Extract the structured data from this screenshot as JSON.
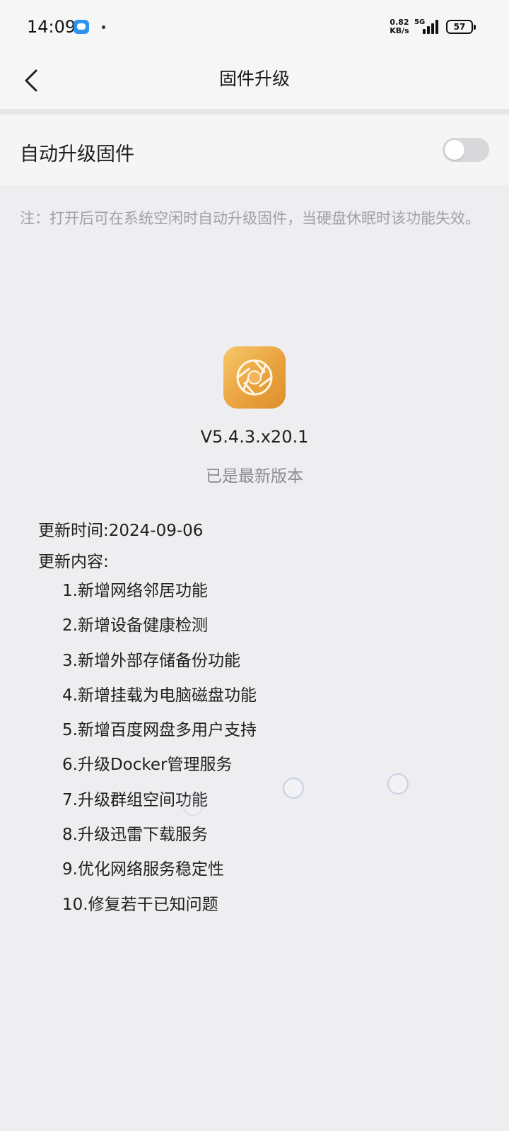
{
  "status_bar": {
    "time": "14:09",
    "speed_value": "0.82",
    "speed_unit": "KB/s",
    "network": "5G",
    "battery": "57"
  },
  "nav": {
    "title": "固件升级",
    "back_icon": "chevron-left-icon"
  },
  "settings": {
    "auto_upgrade_label": "自动升级固件",
    "auto_upgrade_enabled": false
  },
  "note": "注：打开后可在系统空闲时自动升级固件，当硬盘休眠时该功能失效。",
  "firmware": {
    "logo_icon": "aperture-icon",
    "version": "V5.4.3.x20.1",
    "status": "已是最新版本",
    "update_time": "更新时间:2024-09-06",
    "update_content_label": "更新内容:",
    "changelog": [
      "1.新增网络邻居功能",
      "2.新增设备健康检测",
      "3.新增外部存储备份功能",
      "4.新增挂载为电脑磁盘功能",
      "5.新增百度网盘多用户支持",
      "6.升级Docker管理服务",
      "7.升级群组空间功能",
      "8.升级迅雷下载服务",
      "9.优化网络服务稳定性",
      "10.修复若干已知问题"
    ]
  },
  "colors": {
    "background": "#eeeef0",
    "toggle_off": "#d8d8db",
    "logo_gold": "#e9a33e",
    "note_text": "#a2a2a6"
  }
}
